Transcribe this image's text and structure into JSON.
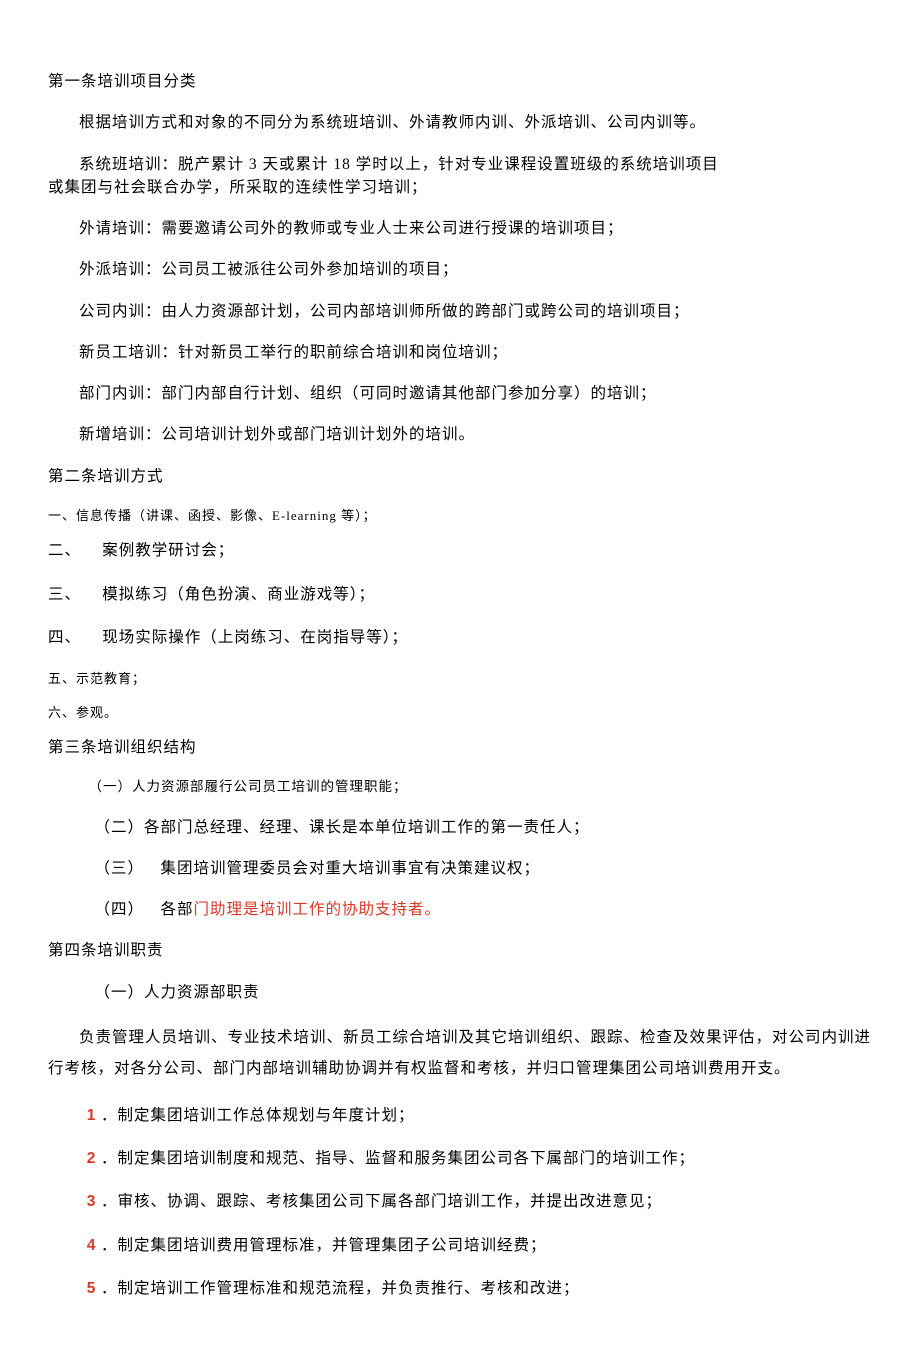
{
  "art1": {
    "title": "第一条培训项目分类",
    "intro": "根据培训方式和对象的不同分为系统班培训、外请教师内训、外派培训、公司内训等。",
    "sys_part1": "系统班培训：脱产累计 3 天或累计 18 学时以上，针对专业课程设置班级的系统培训项目",
    "sys_part2": "或集团与社会联合办学，所采取的连续性学习培训；",
    "p_outreq": "外请培训：需要邀请公司外的教师或专业人士来公司进行授课的培训项目；",
    "p_outsend": "外派培训：公司员工被派往公司外参加培训的项目；",
    "p_internal": "公司内训：由人力资源部计划，公司内部培训师所做的跨部门或跨公司的培训项目；",
    "p_newemp": "新员工培训：针对新员工举行的职前综合培训和岗位培训；",
    "p_dept": "部门内训：部门内部自行计划、组织（可同时邀请其他部门参加分享）的培训；",
    "p_added": "新增培训：公司培训计划外或部门培训计划外的培训。"
  },
  "art2": {
    "title": "第二条培训方式",
    "l1": "一、信息传播（讲课、函授、影像、E-learning 等）；",
    "l2_num": "二、",
    "l2_text": "案例教学研讨会；",
    "l3_num": "三、",
    "l3_text": "模拟练习（角色扮演、商业游戏等）；",
    "l4_num": "四、",
    "l4_text": "现场实际操作（上岗练习、在岗指导等）；",
    "l5": "五、示范教育；",
    "l6": "六、参观。"
  },
  "art3": {
    "title": "第三条培训组织结构",
    "i1": "（一）人力资源部履行公司员工培训的管理职能；",
    "i2": "（二）各部门总经理、经理、课长是本单位培训工作的第一责任人；",
    "i3_pre": "（三） 集团培训管理委员会对重大培训事宜有决策建议权；",
    "i4_pre": "（四） 各部",
    "i4_red": "门助理是培训工作的协助支持者。"
  },
  "art4": {
    "title": "第四条培训职责",
    "sub_title": "（一）人力资源部职责",
    "body": "负责管理人员培训、专业技术培训、新员工综合培训及其它培训组织、跟踪、检查及效果评估，对公司内训进行考核，对各分公司、部门内部培训辅助协调并有权监督和考核，并归口管理集团公司培训费用开支。",
    "n1_idx": "1",
    "n1": "．制定集团培训工作总体规划与年度计划；",
    "n2_idx": "2",
    "n2": "．制定集团培训制度和规范、指导、监督和服务集团公司各下属部门的培训工作；",
    "n3_idx": "3",
    "n3": "．审核、协调、跟踪、考核集团公司下属各部门培训工作，并提出改进意见；",
    "n4_idx": "4",
    "n4": "．制定集团培训费用管理标准，并管理集团子公司培训经费；",
    "n5_idx": "5",
    "n5": "．制定培训工作管理标准和规范流程，并负责推行、考核和改进；"
  }
}
